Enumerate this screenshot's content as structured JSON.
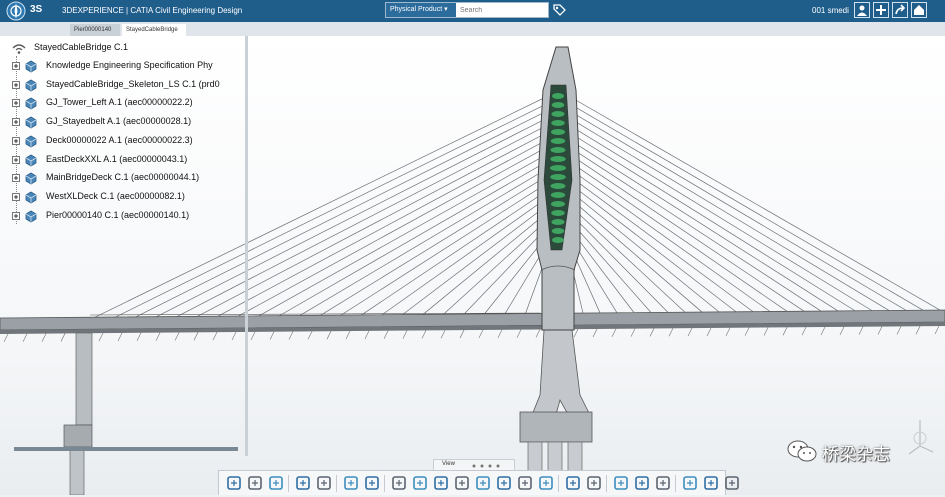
{
  "header": {
    "brand": "3DEXPERIENCE | CATIA Civil Engineering Design",
    "search_filter": "Physical Product",
    "search_placeholder": "Search",
    "user": "001 smedi"
  },
  "tabs": [
    {
      "label": "Pier00000140 A.1"
    },
    {
      "label": "StayedCableBridge C.1"
    }
  ],
  "tree": {
    "root": "StayedCableBridge C.1",
    "items": [
      {
        "label": "Knowledge Engineering Specification Phy",
        "icon": "knowledge-spec-icon"
      },
      {
        "label": "StayedCableBridge_Skeleton_LS C.1 (prd0",
        "icon": "skeleton-icon"
      },
      {
        "label": "GJ_Tower_Left A.1 (aec00000022.2)",
        "icon": "tower-icon"
      },
      {
        "label": "GJ_Stayedbelt A.1 (aec00000028.1)",
        "icon": "stayed-belt-icon"
      },
      {
        "label": "Deck00000022 A.1 (aec00000022.3)",
        "icon": "deck-icon"
      },
      {
        "label": "EastDeckXXL A.1 (aec00000043.1)",
        "icon": "deck-icon"
      },
      {
        "label": "MainBridgeDeck C.1 (aec00000044.1)",
        "icon": "deck-icon"
      },
      {
        "label": "WestXLDeck C.1 (aec00000082.1)",
        "icon": "deck-icon"
      },
      {
        "label": "Pier00000140 C.1 (aec00000140.1)",
        "icon": "pier-icon"
      }
    ]
  },
  "view_widget": {
    "label": "View"
  },
  "toolbar": {
    "buttons": [
      "cut-icon",
      "copy-icon",
      "paste-icon",
      "undo-icon",
      "redo-icon",
      "update-icon",
      "refresh-icon",
      "settings-icon",
      "zoom-icon",
      "cube-icon",
      "pan-icon",
      "move-icon",
      "rotate-icon",
      "search-icon",
      "anchor-icon",
      "section-icon",
      "measure-icon",
      "grid-icon",
      "play-icon",
      "tree-icon",
      "compare-icon",
      "layers-icon",
      "render-icon"
    ]
  },
  "watermark": "桥梁杂志",
  "colors": {
    "header_bg": "#1f5d8b",
    "tower_green": "#3fa45f",
    "cable": "#6b7177",
    "structure": "#8c9196"
  }
}
